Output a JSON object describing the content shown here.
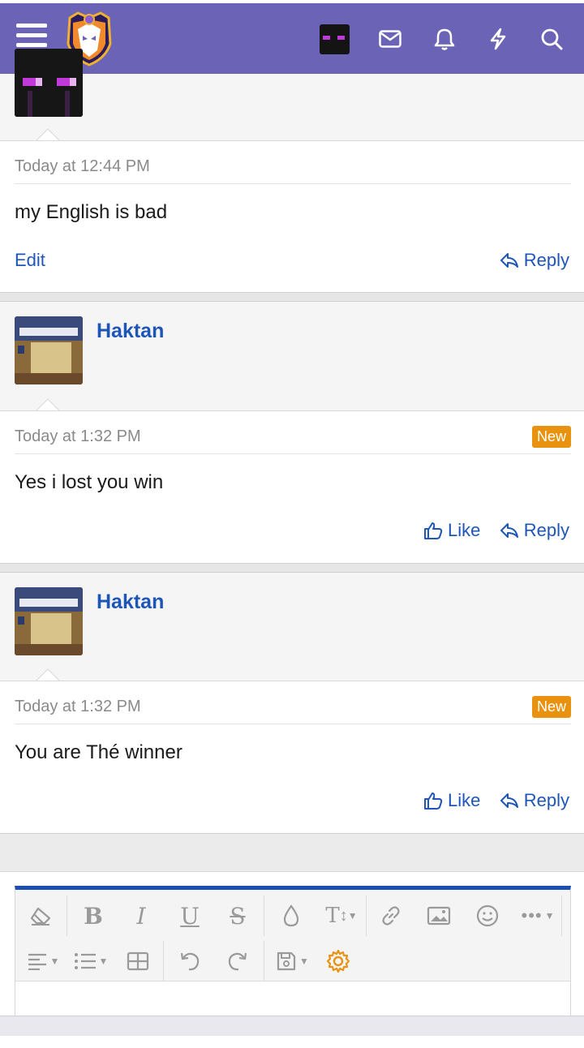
{
  "navbar": {
    "menu_icon": "hamburger-icon",
    "logo_icon": "site-logo",
    "icons": [
      "envelope-icon",
      "bell-icon",
      "lightning-icon",
      "search-icon"
    ],
    "background": "#6b63b5"
  },
  "messages": [
    {
      "date": "Today at 12:44 PM",
      "text": "my English is bad",
      "actions": {
        "edit": "Edit",
        "reply": "Reply"
      }
    },
    {
      "username": "Haktan",
      "date": "Today at 1:32 PM",
      "badge": "New",
      "text": "Yes i lost you win",
      "actions": {
        "like": "Like",
        "reply": "Reply"
      }
    },
    {
      "username": "Haktan",
      "date": "Today at 1:32 PM",
      "badge": "New",
      "text": "You are Thé winner",
      "actions": {
        "like": "Like",
        "reply": "Reply"
      }
    }
  ],
  "editor": {
    "toolbar_row1": [
      "eraser-icon",
      "bold-icon",
      "italic-icon",
      "underline-icon",
      "strikethrough-icon",
      "color-drop-icon",
      "font-size-icon",
      "link-icon",
      "image-icon",
      "smiley-icon",
      "more-icon"
    ],
    "toolbar_row2": [
      "align-icon",
      "list-icon",
      "table-icon",
      "undo-icon",
      "redo-icon",
      "save-draft-icon",
      "settings-gear-icon"
    ],
    "accent": "#1e4fb0",
    "gear_color": "#e8920f"
  },
  "colors": {
    "link": "#1e56b8",
    "badge": "#e8920f",
    "muted": "#8a8a8a"
  }
}
